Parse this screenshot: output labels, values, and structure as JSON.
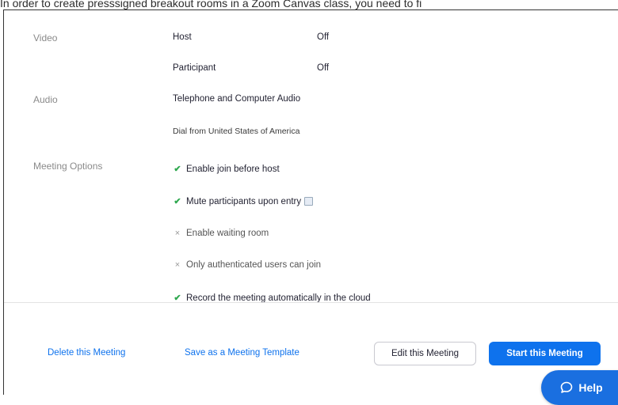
{
  "caption": "In order to create presssigned breakout rooms in a Zoom Canvas class, you need to fi",
  "video": {
    "label": "Video",
    "host_label": "Host",
    "host_value": "Off",
    "participant_label": "Participant",
    "participant_value": "Off"
  },
  "audio": {
    "label": "Audio",
    "value": "Telephone and Computer Audio",
    "dial_from": "Dial from United States of America"
  },
  "meeting_options": {
    "label": "Meeting Options",
    "options": [
      {
        "text": "Enable join before host",
        "enabled": true,
        "mark": "✔"
      },
      {
        "text": "Mute participants upon entry",
        "enabled": true,
        "mark": "✔"
      },
      {
        "text": "Enable waiting room",
        "enabled": false,
        "mark": "×"
      },
      {
        "text": "Only authenticated users can join",
        "enabled": false,
        "mark": "×"
      },
      {
        "text": "Record the meeting automatically in the cloud",
        "enabled": true,
        "mark": "✔"
      }
    ]
  },
  "footer": {
    "delete_link": "Delete this Meeting",
    "template_link": "Save as a Meeting Template",
    "edit_button": "Edit this Meeting",
    "start_button": "Start this Meeting"
  },
  "help": {
    "label": "Help",
    "icon": "chat-bubble-icon"
  },
  "colors": {
    "accent": "#0e72ed",
    "check": "#2fa84f",
    "help_bg": "#1a6fe0"
  }
}
